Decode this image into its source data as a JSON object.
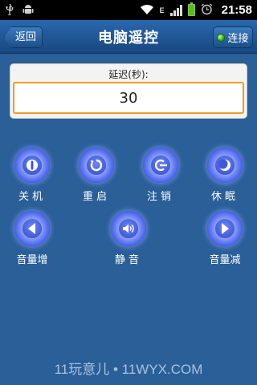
{
  "status_bar": {
    "network_type": "E",
    "time": "21:58",
    "icons": [
      "usb-icon",
      "android-icon",
      "wifi-icon",
      "signal-icon",
      "battery-icon",
      "alarm-icon"
    ]
  },
  "header": {
    "title": "电脑遥控",
    "back_label": "返回",
    "connect_label": "连接"
  },
  "delay": {
    "label": "延迟(秒):",
    "value": "30"
  },
  "buttons": [
    {
      "label": "关机",
      "icon": "power-icon"
    },
    {
      "label": "重启",
      "icon": "restart-icon"
    },
    {
      "label": "注销",
      "icon": "logout-icon"
    },
    {
      "label": "休眠",
      "icon": "sleep-icon"
    },
    {
      "label": "音量增",
      "icon": "volume-up-icon"
    },
    {
      "label": "静音",
      "icon": "mute-icon"
    },
    {
      "label": "音量减",
      "icon": "volume-down-icon"
    }
  ],
  "watermark": "11玩意儿 • 11WYX.COM",
  "colors": {
    "background": "#2a5f98",
    "title_bar": "#1f5a99",
    "input_border": "#f39a21",
    "connected_led": "#3fbf14"
  }
}
